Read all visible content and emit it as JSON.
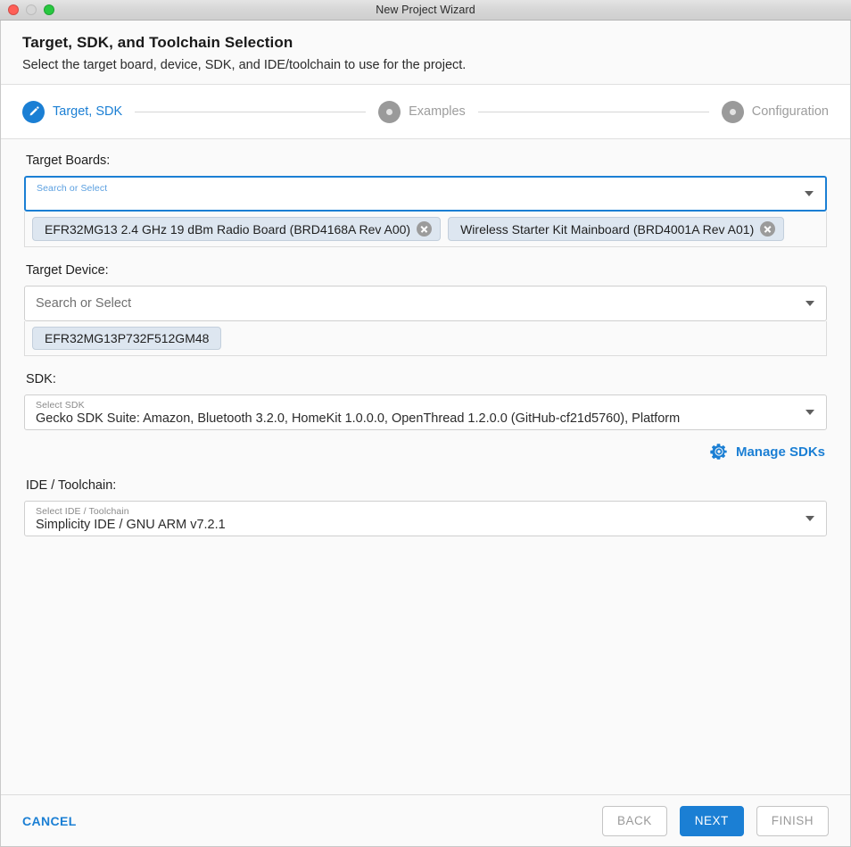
{
  "window": {
    "title": "New Project Wizard",
    "traffic_lights": [
      "close-button",
      "minimize-button",
      "zoom-button"
    ]
  },
  "header": {
    "title": "Target, SDK, and Toolchain Selection",
    "subtitle": "Select the target board, device, SDK, and IDE/toolchain to use for the project."
  },
  "stepper": {
    "steps": [
      {
        "label": "Target, SDK",
        "state": "active",
        "icon": "pencil-icon"
      },
      {
        "label": "Examples",
        "state": "inactive",
        "icon": "dot-icon"
      },
      {
        "label": "Configuration",
        "state": "inactive",
        "icon": "dot-icon"
      }
    ]
  },
  "target_boards": {
    "label": "Target Boards:",
    "placeholder": "Search or Select",
    "focused": true,
    "chips": [
      {
        "text": "EFR32MG13 2.4 GHz 19 dBm Radio Board (BRD4168A Rev A00)",
        "removable": true
      },
      {
        "text": "Wireless Starter Kit Mainboard (BRD4001A Rev A01)",
        "removable": true
      }
    ]
  },
  "target_device": {
    "label": "Target Device:",
    "placeholder": "Search or Select",
    "chips": [
      {
        "text": "EFR32MG13P732F512GM48",
        "removable": false
      }
    ]
  },
  "sdk": {
    "label": "SDK:",
    "float_label": "Select SDK",
    "value": "Gecko SDK Suite: Amazon, Bluetooth 3.2.0, HomeKit 1.0.0.0, OpenThread 1.2.0.0 (GitHub-cf21d5760), Platform",
    "manage_link": "Manage SDKs",
    "manage_icon": "gear-icon"
  },
  "toolchain": {
    "label": "IDE / Toolchain:",
    "float_label": "Select IDE / Toolchain",
    "value": "Simplicity IDE / GNU ARM v7.2.1"
  },
  "footer": {
    "cancel": "CANCEL",
    "back": "BACK",
    "next": "NEXT",
    "finish": "FINISH"
  },
  "colors": {
    "accent": "#1b7fd4",
    "chip_bg": "#dde6f0",
    "page_bg": "#fafafa",
    "muted_text": "#9a9a9a"
  }
}
